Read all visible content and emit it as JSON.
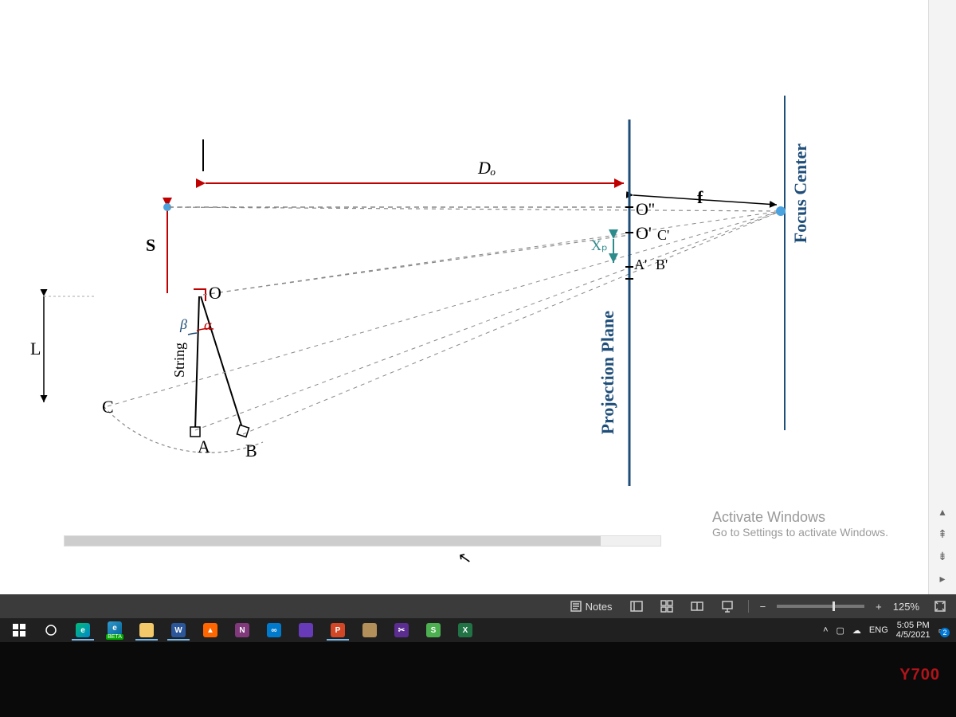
{
  "diagram": {
    "labels": {
      "Do": "Dₒ",
      "f": "f",
      "L": "L",
      "S": "S",
      "O": "O",
      "C": "C",
      "A": "A",
      "B": "B",
      "alpha": "α",
      "beta": "β",
      "String": "String",
      "ProjectionPlane": "Projection Plane",
      "FocusCenter": "Focus Center",
      "Odd": "O''",
      "Oprime": "O'",
      "Cprime": "C'",
      "Aprime": "A'",
      "Bprime": "B'",
      "Xp": "Xₚ"
    }
  },
  "watermark": {
    "title": "Activate Windows",
    "sub": "Go to Settings to activate Windows."
  },
  "statusbar": {
    "notes": "Notes",
    "zoom": "125%",
    "plus": "+",
    "minus": "−"
  },
  "taskbar": {
    "beta": "BETA",
    "lang": "ENG",
    "time": "5:05 PM",
    "date": "4/5/2021"
  },
  "bezel": {
    "brand": "Y700"
  },
  "icons": {
    "notes": "notes-icon",
    "normal_view": "normal-view-icon",
    "sorter": "slide-sorter-icon",
    "reading": "reading-view-icon",
    "slideshow": "slideshow-icon",
    "fit": "fit-to-window-icon"
  }
}
